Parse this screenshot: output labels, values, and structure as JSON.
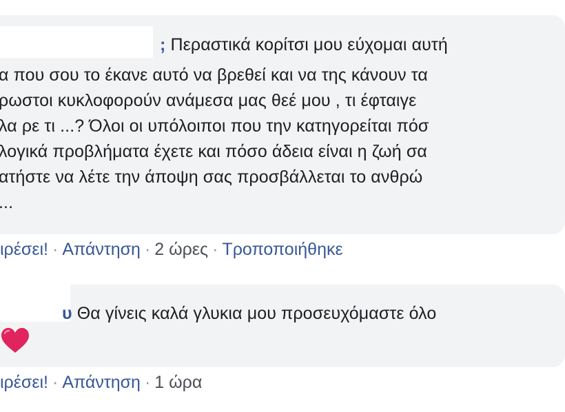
{
  "comments": [
    {
      "author_tail": ";",
      "lines": [
        "Περαστικά κορίτσι μου εύχομαι αυτή",
        "α που σου το έκανε αυτό να βρεθεί και να της κάνουν τα",
        "ρωστοι κυκλοφορούν ανάμεσα μας θεέ μου , τι έφταιγε",
        "λα ρε τι ...? Όλοι οι υπόλοιποι που την κατηγορείται πόσ",
        "λογικά προβλήματα έχετε και πόσο άδεια είναι η ζωή σα",
        "ατήστε να λέτε την άποψη σας προσβάλλεται το ανθρώ",
        "..."
      ],
      "actions": {
        "like": "ιρέσει!",
        "reply": "Απάντηση",
        "time": "2 ώρες",
        "edited": "Τροποποιήθηκε"
      }
    },
    {
      "author_tail": "υ",
      "lines": [
        "Θα γίνεις καλά γλυκια μου προσευχόμαστε όλο"
      ],
      "emoji": "heart-emoji",
      "actions": {
        "like": "ιρέσει!",
        "reply": "Απάντηση",
        "time": "1 ώρα"
      }
    }
  ],
  "separator": "·",
  "colors": {
    "bubble": "#f2f3f5",
    "link": "#385898",
    "text": "#1c1e21",
    "meta": "#4b4f56",
    "heart": "#e0245e"
  }
}
